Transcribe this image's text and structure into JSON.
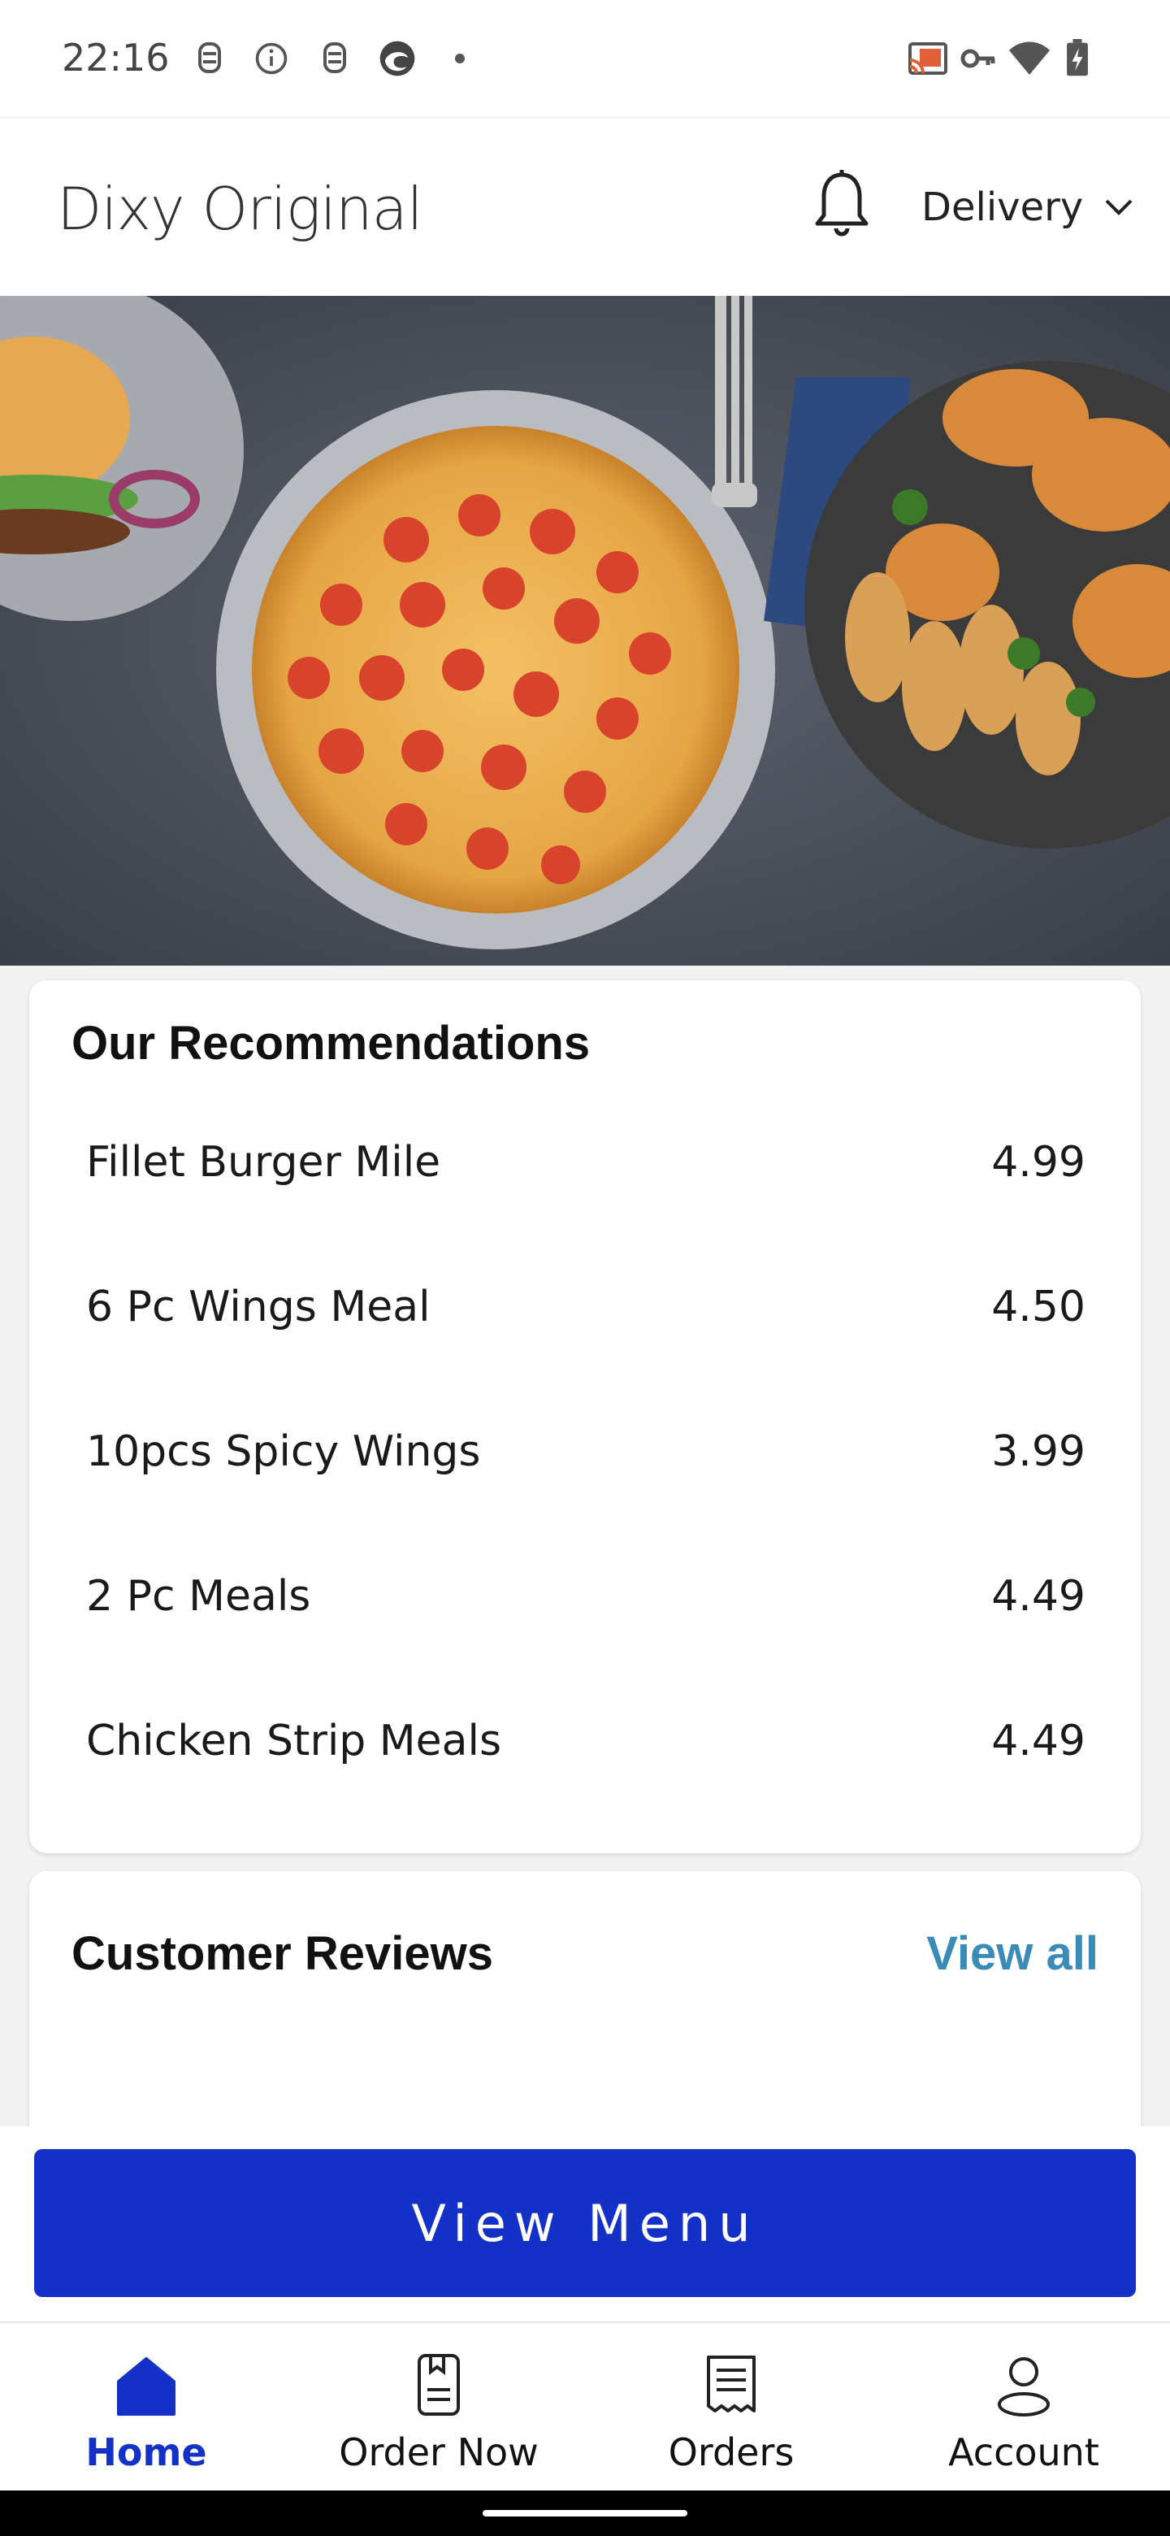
{
  "status_bar": {
    "time": "22:16",
    "left_icons": [
      "app-notification-icon",
      "info-icon",
      "app-notification-icon",
      "edge-browser-icon",
      "dot-icon"
    ],
    "right_icons": [
      "cast-icon",
      "vpn-key-icon",
      "wifi-icon",
      "battery-charging-icon"
    ]
  },
  "header": {
    "title": "Dixy Original",
    "bell_icon": "bell-icon",
    "delivery_label": "Delivery",
    "delivery_icon": "chevron-down-icon"
  },
  "hero": {
    "description_icon": "hero-food-image"
  },
  "recommendations": {
    "title": "Our Recommendations",
    "items": [
      {
        "name": "Fillet Burger Mile",
        "price": "4.99"
      },
      {
        "name": "6 Pc Wings Meal",
        "price": "4.50"
      },
      {
        "name": "10pcs Spicy Wings",
        "price": "3.99"
      },
      {
        "name": "2 Pc Meals",
        "price": "4.49"
      },
      {
        "name": "Chicken Strip Meals",
        "price": "4.49"
      }
    ]
  },
  "reviews": {
    "title": "Customer Reviews",
    "view_all": "View all"
  },
  "view_menu": {
    "label": "View Menu"
  },
  "bottom_nav": {
    "items": [
      {
        "label": "Home",
        "icon": "home-icon",
        "active": true
      },
      {
        "label": "Order Now",
        "icon": "order-now-icon",
        "active": false
      },
      {
        "label": "Orders",
        "icon": "receipt-icon",
        "active": false
      },
      {
        "label": "Account",
        "icon": "account-icon",
        "active": false
      }
    ]
  },
  "colors": {
    "accent": "#1431c7",
    "link": "#3a8bb7",
    "background": "#f2f2f2"
  }
}
